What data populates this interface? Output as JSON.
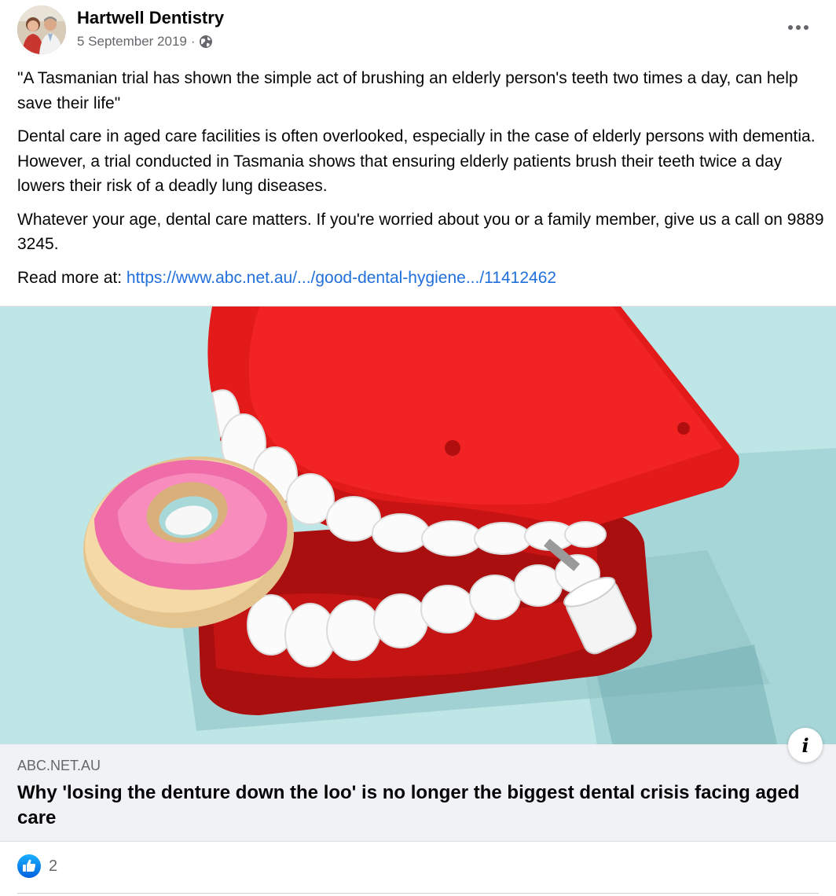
{
  "post": {
    "author": "Hartwell Dentistry",
    "date": "5 September 2019",
    "separator": "·",
    "privacy_icon": "globe-icon",
    "more_icon": "more-options-icon",
    "paragraphs": [
      "\"A Tasmanian trial has shown the simple act of brushing an elderly person's teeth two times a day, can help save their life\"",
      "Dental care in aged care facilities is often overlooked, especially in the case of elderly persons with dementia. However, a trial conducted in Tasmania shows that ensuring elderly patients brush their teeth twice a day lowers their risk of a deadly lung diseases.",
      "Whatever your age, dental care matters. If you're worried about you or a family member, give us a call on 9889 3245."
    ],
    "read_more_label": "Read more at: ",
    "read_more_link": "https://www.abc.net.au/.../good-dental-hygiene.../11412462"
  },
  "link_preview": {
    "domain": "ABC.NET.AU",
    "title": "Why 'losing the denture down the loo' is no longer the biggest dental crisis facing aged care",
    "info_icon": "info-icon",
    "info_label": "i"
  },
  "reactions": {
    "icon": "like-icon",
    "count": "2"
  },
  "colors": {
    "link": "#216fdb",
    "like_blue": "#1877f2",
    "preview_bg": "#f0f2f5",
    "secondary_text": "#65676b"
  }
}
